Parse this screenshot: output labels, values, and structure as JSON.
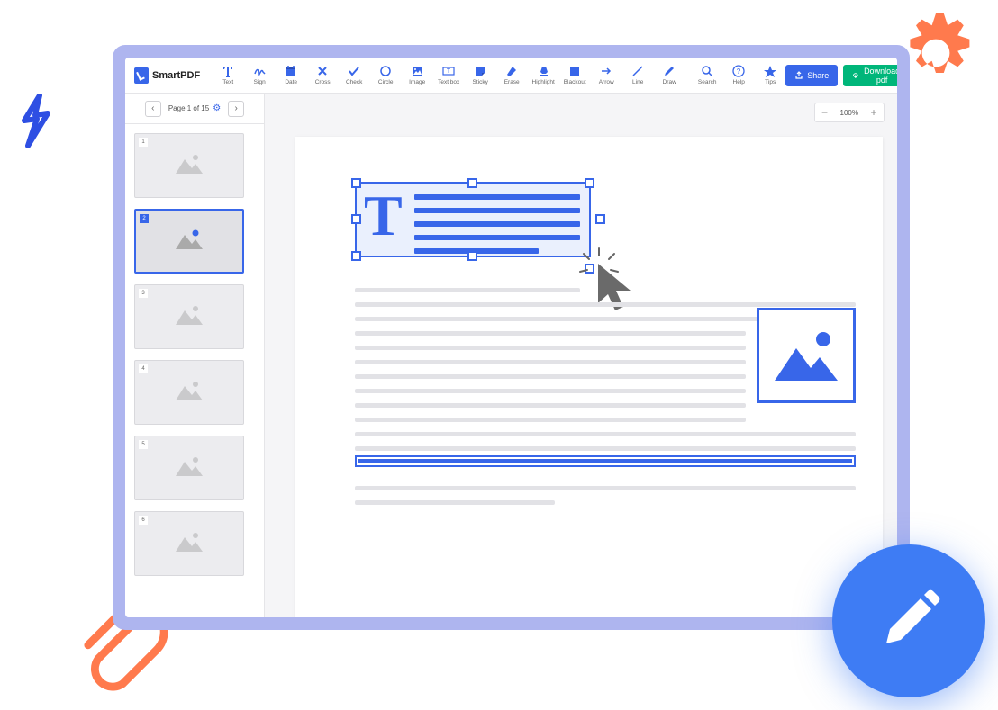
{
  "app": {
    "name": "SmartPDF"
  },
  "toolbar": {
    "tools": [
      {
        "id": "text",
        "label": "Text"
      },
      {
        "id": "sign",
        "label": "Sign"
      },
      {
        "id": "date",
        "label": "Date"
      },
      {
        "id": "cross",
        "label": "Cross"
      },
      {
        "id": "check",
        "label": "Check"
      },
      {
        "id": "circle",
        "label": "Circle"
      },
      {
        "id": "image",
        "label": "Image"
      },
      {
        "id": "textbox",
        "label": "Text box"
      },
      {
        "id": "sticky",
        "label": "Sticky"
      },
      {
        "id": "erase",
        "label": "Erase"
      },
      {
        "id": "highlight",
        "label": "Highlight"
      },
      {
        "id": "blackout",
        "label": "Blackout"
      },
      {
        "id": "arrow",
        "label": "Arrow"
      },
      {
        "id": "line",
        "label": "Line"
      },
      {
        "id": "draw",
        "label": "Draw"
      }
    ],
    "utility": [
      {
        "id": "search",
        "label": "Search"
      },
      {
        "id": "help",
        "label": "Help"
      },
      {
        "id": "tips",
        "label": "Tips"
      }
    ],
    "share": "Share",
    "download": "Download pdf"
  },
  "sidebar": {
    "page_label": "Page 1 of 15",
    "total_pages": 15,
    "thumbs": [
      1,
      2,
      3,
      4,
      5,
      6
    ],
    "active": 2
  },
  "zoom": {
    "value": "100%"
  },
  "colors": {
    "primary": "#3866e9",
    "success": "#00b67a",
    "deco_orange": "#ff7a4d"
  }
}
